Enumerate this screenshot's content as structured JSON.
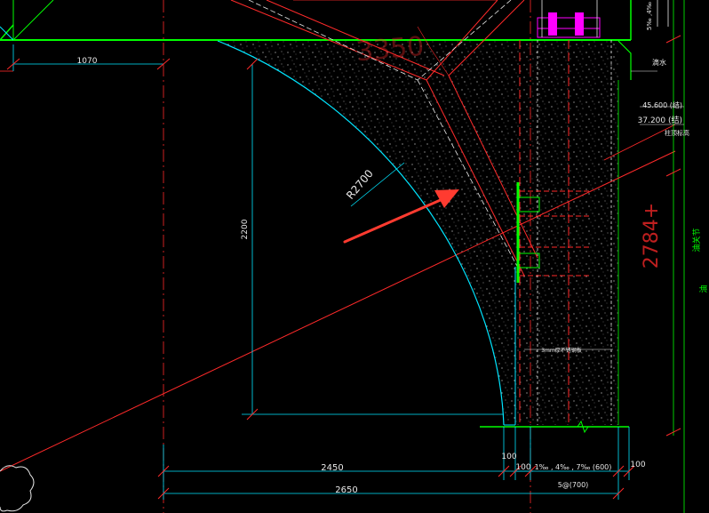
{
  "drawing": {
    "dims": {
      "d1070": "1070",
      "d2450": "2450",
      "d2650": "2650",
      "d2200": "2200",
      "d100_a": "100",
      "d100_b": "100",
      "d100_c": "100",
      "rebar_spec": "1‰ , 4‰ , 7‰ (600)",
      "rebar_total": "5@(700)",
      "radius": "R2700",
      "d2784": "2784+",
      "d3350": "3350",
      "small_top": "5‰ ,4‰"
    },
    "notes": {
      "drip": "滴水",
      "elev1": "45.600 (结)",
      "elev2": "37.200 (结)",
      "elev_label": "柱顶标高",
      "plate_note": "3mm厚不锈钢板",
      "right_note": "油关节",
      "right_cut": "油"
    },
    "colors": {
      "green": "#00ff00",
      "red": "#ff2a2a",
      "cyan": "#00e5ff",
      "white": "#e8e8e8",
      "magenta": "#ff00ff",
      "arrow": "#ff3b30"
    }
  }
}
